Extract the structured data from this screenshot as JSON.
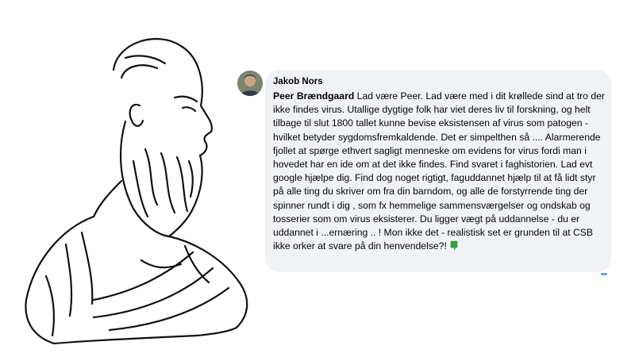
{
  "comment": {
    "author": "Jakob Nors",
    "mention": "Peer Brændgaard",
    "body": " Lad være Peer. Lad være med i dit krøllede sind at tro der ikke findes virus. Utallige dygtige folk har viet deres liv til forskning, og helt tilbage til slut 1800 tallet kunne bevise eksistensen af virus som patogen - hvilket betyder sygdomsfremkaldende. Det er simpelthen så .... Alarmerende fjollet at spørge ethvert sagligt menneske om evidens for virus fordi man i hovedet har en ide om at det ikke findes. Find svaret i faghistorien. Lad evt google hjælpe dig. Find dog noget rigtigt, faguddannet hjælp til at få lidt styr på alle ting du skriver om fra din barndom, og alle de forstyrrende ting der spinner rundt i dig , som fx hemmelige sammensværgelser og ondskab og tosserier som om virus eksisterer. Du ligger vægt på uddannelse - du er uddannet i ...ernæring .. ! Mon ikke det - realistisk set er grunden til at CSB ikke orker at svare på din henvendelse?!",
    "emoji": "four-leaf-clover-icon"
  },
  "colors": {
    "bubble_bg": "#f0f2f5",
    "text": "#050505",
    "clover": "#2e9e3a"
  }
}
